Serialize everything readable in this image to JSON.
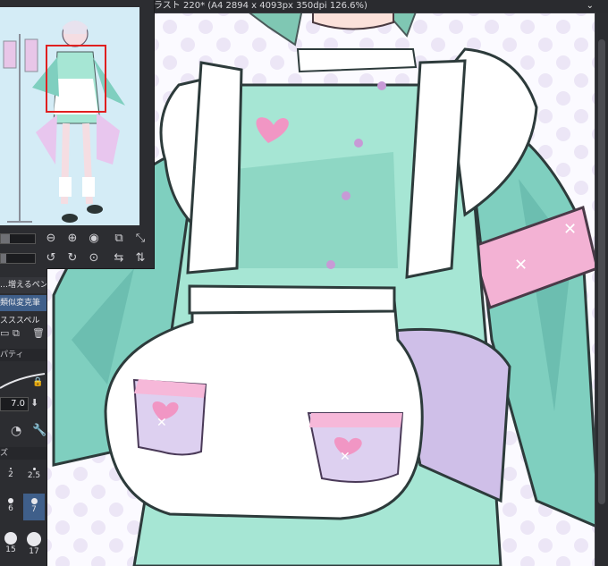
{
  "window": {
    "title": "ラスト 220* (A4 2894 x 4093px 350dpi 126.6%)"
  },
  "tools": {
    "items": [
      "…増えるペン",
      "類似変克筆",
      "スススペル"
    ],
    "property_label": "パティ",
    "brush_size_value": "7.0",
    "size_section_label": "ズ"
  },
  "brush_sizes": [
    "2",
    "2.5",
    "6",
    "7",
    "15",
    "17"
  ],
  "colors": {
    "panel_bg": "#2c2d31",
    "canvas_bg": "#fbfaff",
    "mint": "#8fd9c6",
    "pink": "#f4a9d2",
    "lavender": "#cdbce8",
    "nav_frame": "#e02020"
  },
  "icons": {
    "navigator": [
      "zoom-out-icon",
      "zoom-in-icon",
      "fit-icon",
      "fit-window-icon",
      "flip-icon",
      "rotate-left-icon",
      "rotate-right-icon",
      "reset-rotation-icon",
      "mirror-horizontal-icon",
      "mirror-vertical-icon"
    ],
    "tools": [
      "layer-icon",
      "copy-icon",
      "trash-icon",
      "lock-icon",
      "stepper-icon",
      "brush-size-icon",
      "wrench-icon"
    ]
  }
}
